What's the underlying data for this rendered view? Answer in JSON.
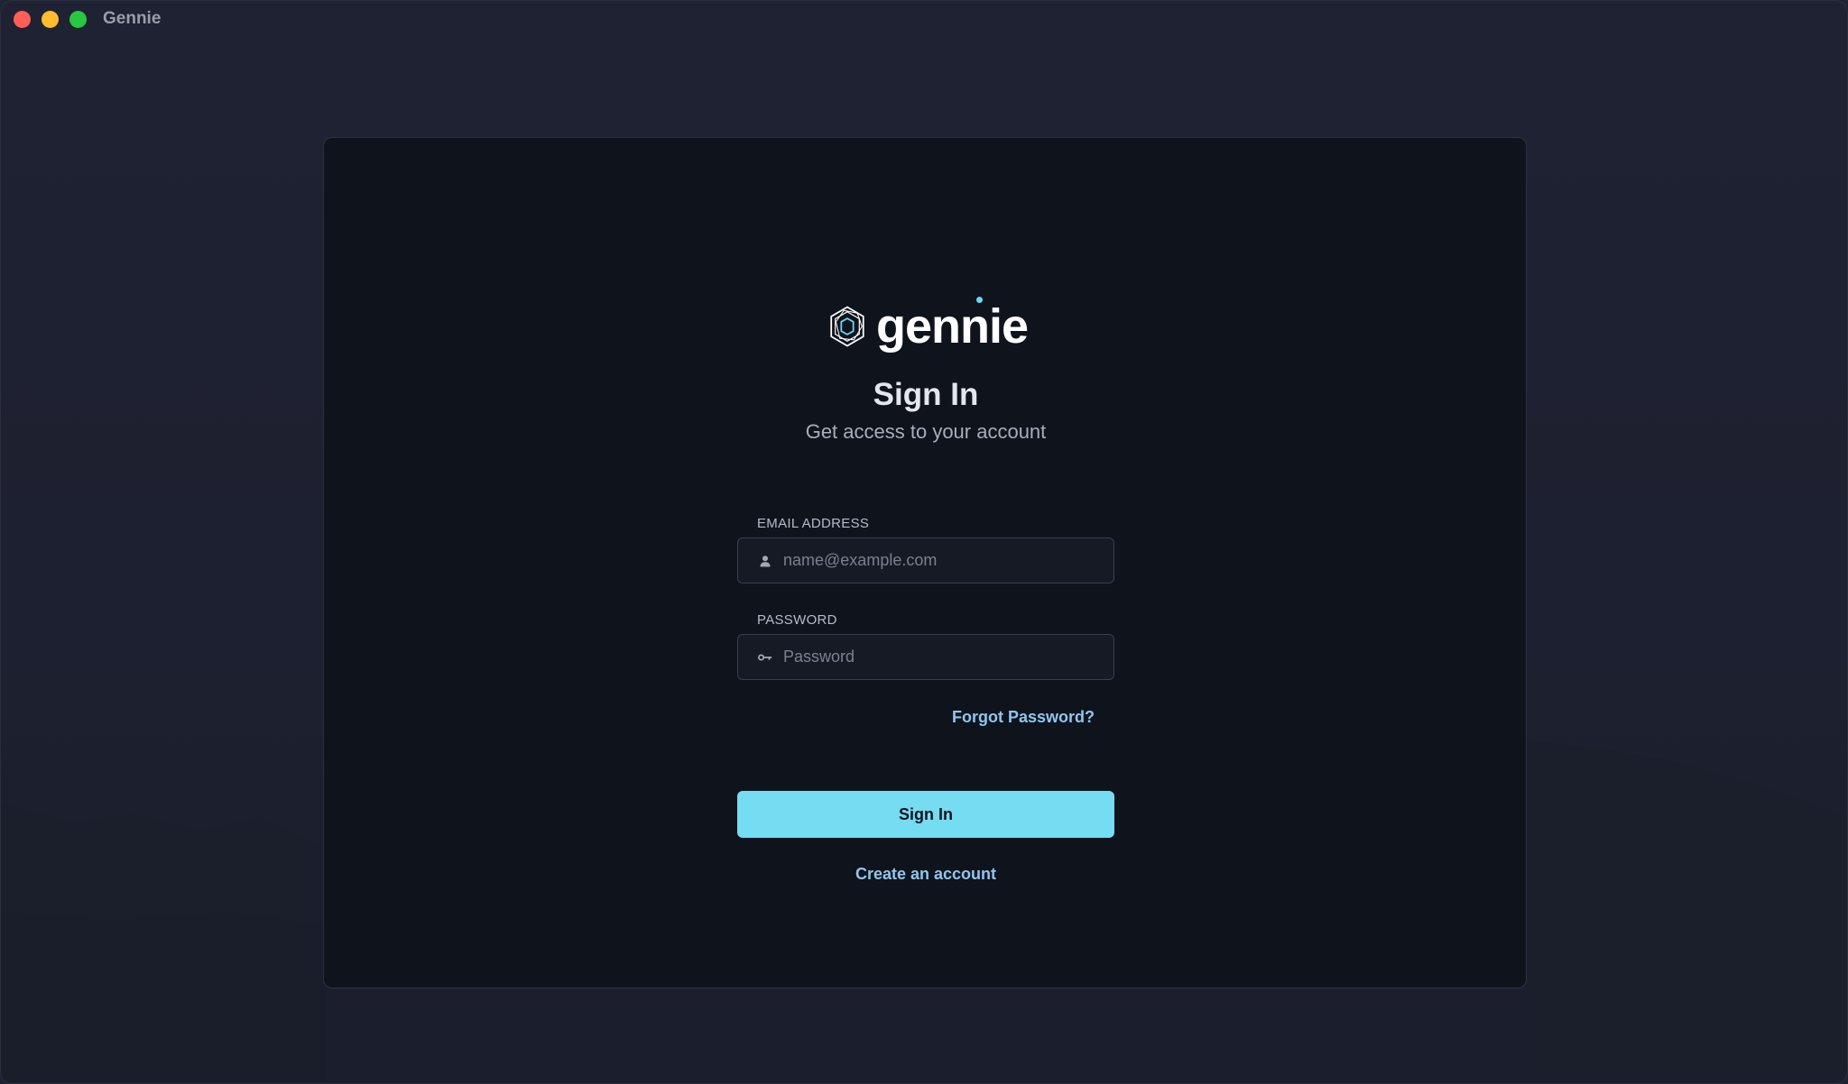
{
  "window": {
    "title": "Gennie"
  },
  "brand": {
    "wordmark": "gennie",
    "logo_icon": "hexagon-logo-icon",
    "accent_color": "#76dcf2"
  },
  "login": {
    "title": "Sign In",
    "subtitle": "Get access to your account",
    "email": {
      "label": "EMAIL ADDRESS",
      "placeholder": "name@example.com",
      "value": "",
      "icon": "user-icon"
    },
    "password": {
      "label": "PASSWORD",
      "placeholder": "Password",
      "value": "",
      "icon": "key-icon"
    },
    "forgot_label": "Forgot Password?",
    "submit_label": "Sign In",
    "create_account_label": "Create an account"
  }
}
